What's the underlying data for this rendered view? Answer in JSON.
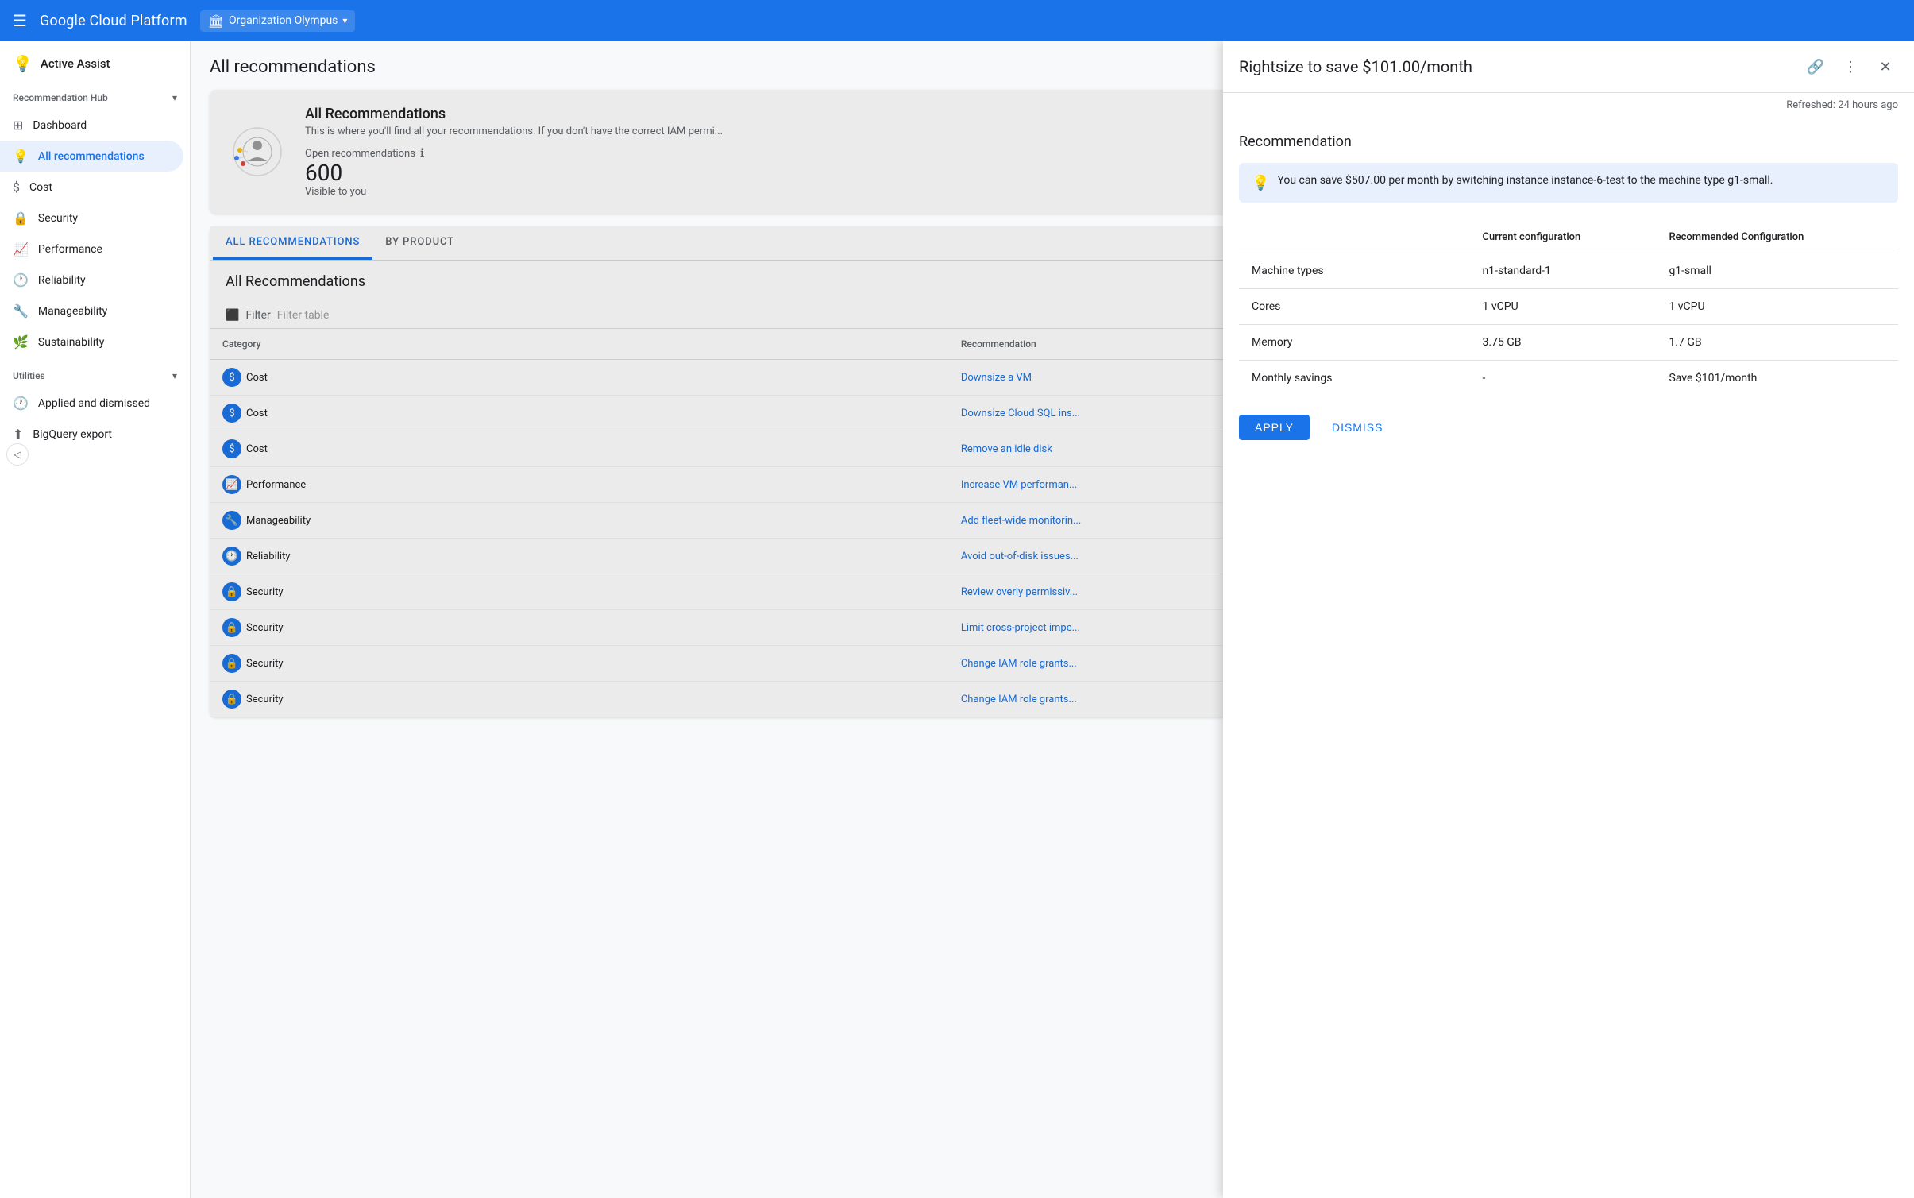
{
  "topNav": {
    "hamburger": "☰",
    "brand": "Google Cloud Platform",
    "org": {
      "icon": "🏛",
      "label": "Organization Olympus",
      "chevron": "▾"
    }
  },
  "sidebar": {
    "header": {
      "icon": "💡",
      "label": "Active Assist"
    },
    "sections": [
      {
        "label": "Recommendation Hub",
        "chevron": "▾",
        "items": [
          {
            "icon": "⊞",
            "label": "Dashboard",
            "active": false
          },
          {
            "icon": "💡",
            "label": "All recommendations",
            "active": true
          },
          {
            "icon": "$",
            "label": "Cost",
            "active": false
          },
          {
            "icon": "🔒",
            "label": "Security",
            "active": false
          },
          {
            "icon": "📈",
            "label": "Performance",
            "active": false
          },
          {
            "icon": "🕐",
            "label": "Reliability",
            "active": false
          },
          {
            "icon": "🔧",
            "label": "Manageability",
            "active": false
          },
          {
            "icon": "🌿",
            "label": "Sustainability",
            "active": false
          }
        ]
      },
      {
        "label": "Utilities",
        "chevron": "▾",
        "items": [
          {
            "icon": "🕐",
            "label": "Applied and dismissed",
            "active": false
          },
          {
            "icon": "⬆",
            "label": "BigQuery export",
            "active": false
          }
        ]
      }
    ]
  },
  "content": {
    "pageTitle": "All recommendations",
    "card": {
      "title": "All Recommendations",
      "description": "This is where you'll find all your recommendations. If you don't have the correct IAM permissions...",
      "openRecs": {
        "label": "Open recommendations",
        "count": "600",
        "sublabel": "Visible to you"
      }
    },
    "tabs": [
      {
        "label": "ALL RECOMMENDATIONS",
        "active": true
      },
      {
        "label": "BY PRODUCT",
        "active": false
      }
    ],
    "tableSection": {
      "title": "All Recommendations",
      "filter": {
        "icon": "⬛",
        "label": "Filter",
        "placeholder": "Filter table"
      },
      "columns": [
        "Category",
        "Recommendation"
      ],
      "rows": [
        {
          "category": "Cost",
          "catType": "cost",
          "recommendation": "Downsize a VM"
        },
        {
          "category": "Cost",
          "catType": "cost",
          "recommendation": "Downsize Cloud SQL ins..."
        },
        {
          "category": "Cost",
          "catType": "cost",
          "recommendation": "Remove an idle disk"
        },
        {
          "category": "Performance",
          "catType": "perf",
          "recommendation": "Increase VM performan..."
        },
        {
          "category": "Manageability",
          "catType": "manage",
          "recommendation": "Add fleet-wide monitorin..."
        },
        {
          "category": "Reliability",
          "catType": "reliability",
          "recommendation": "Avoid out-of-disk issues..."
        },
        {
          "category": "Security",
          "catType": "security",
          "recommendation": "Review overly permissiv..."
        },
        {
          "category": "Security",
          "catType": "security",
          "recommendation": "Limit cross-project impe..."
        },
        {
          "category": "Security",
          "catType": "security",
          "recommendation": "Change IAM role grants..."
        },
        {
          "category": "Security",
          "catType": "security",
          "recommendation": "Change IAM role grants..."
        }
      ]
    }
  },
  "panel": {
    "title": "Rightsize to save $101.00/month",
    "refreshed": "Refreshed: 24 hours ago",
    "sectionTitle": "Recommendation",
    "infoBanner": "You can save $507.00 per month by switching instance instance-6-test to the machine type g1-small.",
    "table": {
      "columns": [
        "",
        "Current configuration",
        "Recommended Configuration"
      ],
      "rows": [
        {
          "label": "Machine types",
          "current": "n1-standard-1",
          "recommended": "g1-small"
        },
        {
          "label": "Cores",
          "current": "1 vCPU",
          "recommended": "1 vCPU"
        },
        {
          "label": "Memory",
          "current": "3.75 GB",
          "recommended": "1.7 GB"
        },
        {
          "label": "Monthly savings",
          "current": "-",
          "recommended": "Save $101/month"
        }
      ]
    },
    "buttons": {
      "apply": "APPLY",
      "dismiss": "DISMISS"
    },
    "actions": {
      "link": "🔗",
      "more": "⋮",
      "close": "✕"
    }
  }
}
